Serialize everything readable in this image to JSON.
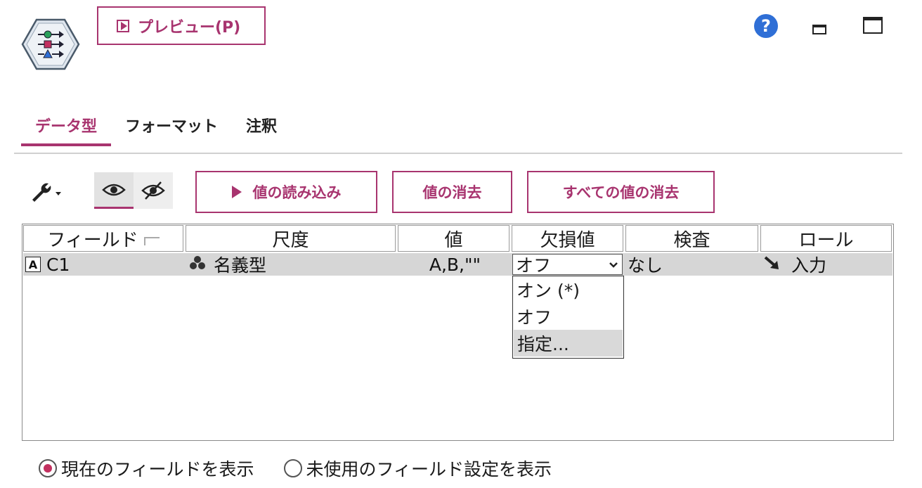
{
  "header": {
    "preview_label": "プレビュー(P)",
    "help_glyph": "?"
  },
  "tabs": [
    {
      "label": "データ型",
      "active": true
    },
    {
      "label": "フォーマット",
      "active": false
    },
    {
      "label": "注釈",
      "active": false
    }
  ],
  "toolbar": {
    "read_values_label": "値の読み込み",
    "clear_values_label": "値の消去",
    "clear_all_values_label": "すべての値の消去"
  },
  "table": {
    "columns": [
      "フィールド",
      "尺度",
      "値",
      "欠損値",
      "検査",
      "ロール"
    ],
    "rows": [
      {
        "field": "C1",
        "field_type_glyph": "A",
        "measure": "名義型",
        "values": "A,B,\"\"",
        "missing": "オフ",
        "check": "なし",
        "role": "入力"
      }
    ]
  },
  "missing_dropdown": {
    "options": [
      "オン (*)",
      "オフ",
      "指定..."
    ],
    "highlighted": "指定..."
  },
  "view_options": {
    "show_current_label": "現在のフィールドを表示",
    "show_unused_label": "未使用のフィールド設定を表示",
    "selected": "show_current"
  },
  "colors": {
    "accent": "#a8346f",
    "help_blue": "#2f6fd6",
    "row_bg": "#d6d6d6"
  }
}
